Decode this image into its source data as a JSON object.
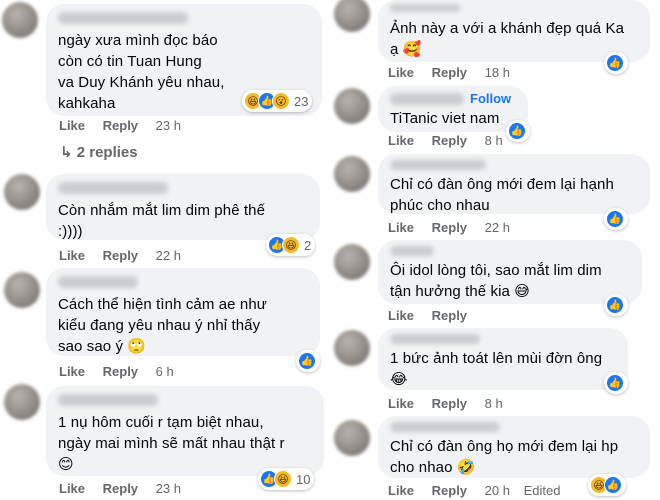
{
  "left": {
    "comments": [
      {
        "text": [
          "ngày xưa mình đọc báo",
          "còn có tin Tuan Hung",
          "va Duy Khánh yêu nhau,",
          "kahkaha"
        ],
        "like": "Like",
        "reply": "Reply",
        "time": "23 h",
        "reactions": {
          "icons": [
            "haha-icon",
            "like-icon",
            "wow-icon"
          ],
          "count": "23"
        }
      },
      {
        "text": [
          "Còn nhắm mắt lim dim phê thế",
          ":))))"
        ],
        "like": "Like",
        "reply": "Reply",
        "time": "22 h",
        "reactions": {
          "icons": [
            "like-icon",
            "haha-icon"
          ],
          "count": "2"
        }
      },
      {
        "text": [
          "Cách thể hiện tình cảm ae như",
          "kiểu đang yêu nhau ý nhỉ thấy",
          "sao sao ý 🙄"
        ],
        "like": "Like",
        "reply": "Reply",
        "time": "6 h",
        "reactions": {
          "icons": [
            "like-icon"
          ],
          "count": ""
        }
      },
      {
        "text": [
          "1 nụ hôm cuối r tạm biệt nhau,",
          "ngày mai mình sẽ mất nhau thật r",
          "😊"
        ],
        "like": "Like",
        "reply": "Reply",
        "time": "23 h",
        "reactions": {
          "icons": [
            "like-icon",
            "haha-icon"
          ],
          "count": "10"
        }
      }
    ],
    "replies_link": "↳ 2 replies"
  },
  "right": {
    "comments": [
      {
        "text": [
          "Ảnh này a với a khánh đẹp quá Ka",
          "ạ 🥰"
        ],
        "like": "Like",
        "reply": "Reply",
        "time": "18 h",
        "reactions": {
          "icons": [
            "like-icon"
          ],
          "count": ""
        }
      },
      {
        "follow": "Follow",
        "text": [
          "TiTanic viet nam"
        ],
        "like": "Like",
        "reply": "Reply",
        "time": "8 h",
        "reactions": {
          "icons": [
            "like-icon"
          ],
          "count": ""
        }
      },
      {
        "text": [
          "Chỉ có đàn ông mới đem lại hạnh",
          "phúc cho nhau"
        ],
        "like": "Like",
        "reply": "Reply",
        "time": "22 h",
        "reactions": {
          "icons": [
            "like-icon"
          ],
          "count": ""
        }
      },
      {
        "text": [
          "Ôi idol lòng tôi, sao mắt lim dim",
          "tận hưởng thế kia 😅"
        ],
        "like": "Like",
        "reply": "Reply",
        "time": "",
        "reactions": {
          "icons": [
            "like-icon"
          ],
          "count": ""
        }
      },
      {
        "text": [
          "1 bức ảnh toát lên mùi đờn ông",
          "😂"
        ],
        "like": "Like",
        "reply": "Reply",
        "time": "8 h",
        "reactions": {
          "icons": [
            "like-icon"
          ],
          "count": ""
        }
      },
      {
        "text": [
          "Chỉ có đàn ông họ mới đem lại hp",
          "cho nhao 🤣"
        ],
        "like": "Like",
        "reply": "Reply",
        "time": "20 h",
        "edited": "Edited",
        "reactions": {
          "icons": [
            "haha-icon",
            "like-icon"
          ],
          "count": ""
        }
      }
    ]
  },
  "colors": {
    "bubble": "#f0f2f5",
    "like_blue": "#1877f2",
    "meta_gray": "#65676b",
    "haha_yellow": "#f7b928"
  }
}
